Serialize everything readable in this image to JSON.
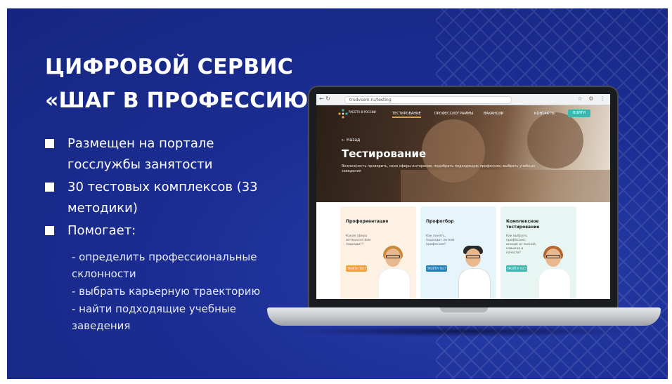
{
  "slide": {
    "title_line1": "ЦИФРОВОЙ СЕРВИС",
    "title_line2": "«ШАГ В ПРОФЕССИЮ»",
    "bullets": [
      "Размещен на портале госслужбы занятости",
      "30 тестовых комплексов (33 методики)",
      "Помогает:"
    ],
    "sub_items": [
      "- определить профессиональные склонности",
      "- выбрать карьерную траекторию",
      "- найти подходящие учебные заведения"
    ]
  },
  "laptop_screen": {
    "browser": {
      "url": "trudvsem.ru/testing",
      "nav_icons": [
        "back-icon",
        "refresh-icon"
      ]
    },
    "site": {
      "logo_text": "РАБОТА В РОССИИ",
      "menu": [
        "ТЕСТИРОВАНИЕ",
        "ПРОФЕССИОГРАММЫ",
        "ВАКАНСИИ",
        "КОНТАКТЫ"
      ],
      "login_label": "ВОЙТИ",
      "back_label": "Назад",
      "hero_title": "Тестирование",
      "hero_desc": "Возможность проверить, свои сферы интересов, подобрать подходящую профессию, выбрать учебные заведения",
      "cards": [
        {
          "title": "Профориентация",
          "desc": "Какая сфера интересна вам подходит?",
          "button": "ПРОЙТИ ТЕСТ"
        },
        {
          "title": "Профотбор",
          "desc": "Как понять, подходит ли вам профессия?",
          "button": "ПРОЙТИ ТЕСТ"
        },
        {
          "title": "Комплексное тестирование",
          "desc": "Как выбрать профессию, исходя из знаний, навыков и качеств?",
          "button": "ПРОЙТИ ТЕСТ"
        }
      ]
    }
  },
  "colors": {
    "slide_bg": "#1b2d93",
    "accent_orange": "#f0a13b",
    "accent_teal": "#39b7b0",
    "card1_bg": "#fdf1e3",
    "card2_bg": "#e6f5fb",
    "card3_bg": "#e7f6f2"
  }
}
